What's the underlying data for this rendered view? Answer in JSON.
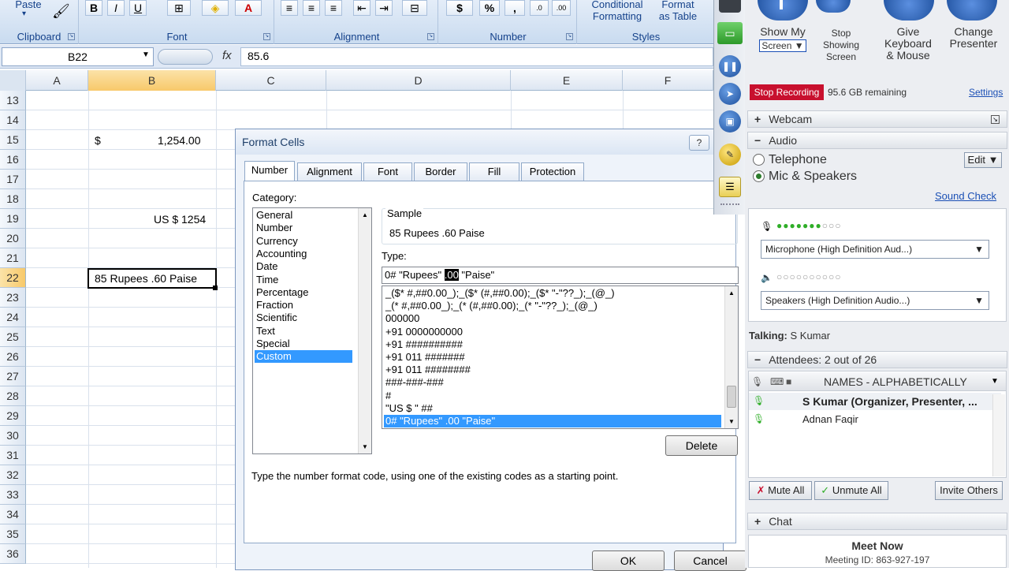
{
  "ribbon": {
    "paste_label": "Paste",
    "groups": {
      "clipboard": "Clipboard",
      "font": "Font",
      "alignment": "Alignment",
      "number": "Number",
      "styles": "Styles"
    },
    "bold": "B",
    "italic": "I",
    "underline": "U",
    "currency_symbol": "$",
    "percent_symbol": "%",
    "comma_symbol": ",",
    "conditional_formatting": "Conditional\nFormatting",
    "format_as_table": "Format\nas Table"
  },
  "formula_bar": {
    "name_box": "B22",
    "fx": "fx",
    "value": "85.6"
  },
  "grid": {
    "columns": [
      "A",
      "B",
      "C",
      "D",
      "E",
      "F"
    ],
    "rows": [
      "13",
      "14",
      "15",
      "16",
      "17",
      "18",
      "19",
      "20",
      "21",
      "22",
      "23",
      "24",
      "25",
      "26",
      "27",
      "28",
      "29",
      "30",
      "31",
      "32",
      "33",
      "34",
      "35",
      "36"
    ],
    "cells": {
      "b15_symbol": "$",
      "b15_value": "1,254.00",
      "b19": "US $  1254",
      "b22": "85 Rupees .60 Paise"
    }
  },
  "dialog": {
    "title": "Format Cells",
    "help": "?",
    "tabs": [
      "Number",
      "Alignment",
      "Font",
      "Border",
      "Fill",
      "Protection"
    ],
    "category_label": "Category:",
    "categories": [
      "General",
      "Number",
      "Currency",
      "Accounting",
      "Date",
      "Time",
      "Percentage",
      "Fraction",
      "Scientific",
      "Text",
      "Special",
      "Custom"
    ],
    "selected_category": "Custom",
    "sample_label": "Sample",
    "sample_value": "85 Rupees .60 Paise",
    "type_label": "Type:",
    "type_value_before": "0# \"Rupees\" ",
    "type_value_highlight": ".00",
    "type_value_after": " \"Paise\"",
    "type_list": [
      "_($* #,##0.00_);_($* (#,##0.00);_($* \"-\"??_);_(@_)",
      "_(* #,##0.00_);_(* (#,##0.00);_(* \"-\"??_);_(@_)",
      "000000",
      "+91 0000000000",
      "+91 ##########",
      "+91 011 #######",
      "+91 011 ########",
      "###-###-###",
      "#",
      "\"US $ \" ##",
      "0# \"Rupees\" .00 \"Paise\""
    ],
    "selected_type": "0# \"Rupees\" .00 \"Paise\"",
    "delete_button": "Delete",
    "hint": "Type the number format code, using one of the existing codes as a starting point.",
    "ok_button": "OK",
    "cancel_button": "Cancel"
  },
  "meeting": {
    "show_my_screen": "Show My",
    "screen_dropdown": "Screen",
    "stop_showing_screen": "Stop\nShowing\nScreen",
    "give_keyboard_mouse": "Give\nKeyboard\n& Mouse",
    "change_presenter": "Change\nPresenter",
    "stop_recording": "Stop Recording",
    "storage_remaining": "95.6 GB remaining",
    "settings_link": "Settings",
    "webcam_label": "Webcam",
    "audio_label": "Audio",
    "telephone_option": "Telephone",
    "mic_speakers_option": "Mic & Speakers",
    "edit_button": "Edit",
    "sound_check_link": "Sound Check",
    "microphone_select": "Microphone (High Definition Aud...)",
    "speakers_select": "Speakers (High Definition Audio...)",
    "talking_label": "Talking:",
    "talking_name": "S Kumar",
    "attendees_label": "Attendees:",
    "attendees_count": "2 out of 26",
    "names_sort": "NAMES - ALPHABETICALLY",
    "attendee_1": "S Kumar (Organizer, Presenter, ...",
    "attendee_2": "Adnan Faqir",
    "mute_all": "Mute All",
    "unmute_all": "Unmute All",
    "invite_others": "Invite Others",
    "chat_label": "Chat",
    "meet_now": "Meet Now",
    "meeting_id": "Meeting ID: 863-927-197",
    "colors": {
      "accent_blue": "#1d4f9c",
      "recording_red": "#c8102e",
      "mic_green": "#2fae28"
    }
  }
}
